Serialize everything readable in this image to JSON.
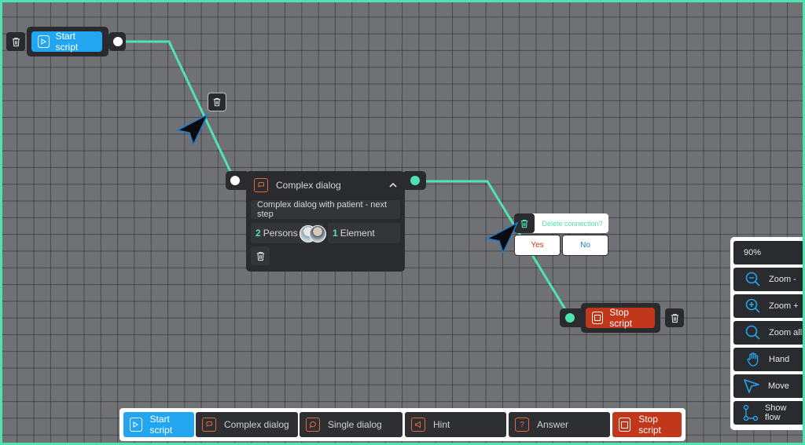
{
  "canvas": {
    "start_node": {
      "label": "Start script"
    },
    "complex_node": {
      "title": "Complex dialog",
      "description": "Complex dialog with  patient - next step",
      "persons_count": "2",
      "persons_label": "Persons",
      "elements_count": "1",
      "elements_label": "Element"
    },
    "stop_node": {
      "label": "Stop script"
    },
    "delete_popup": {
      "question": "Delete connection?",
      "yes": "Yes",
      "no": "No"
    }
  },
  "right_panel": {
    "zoom_level": "90%",
    "items": [
      {
        "label": "Zoom -",
        "icon": "zoom-out-icon"
      },
      {
        "label": "Zoom +",
        "icon": "zoom-in-icon"
      },
      {
        "label": "Zoom all",
        "icon": "zoom-all-icon"
      },
      {
        "label": "Hand",
        "icon": "hand-icon"
      },
      {
        "label": "Move",
        "icon": "cursor-icon"
      },
      {
        "label": "Show flow",
        "icon": "flow-icon"
      }
    ]
  },
  "bottom_toolbar": {
    "items": [
      {
        "label": "Start script",
        "icon": "play-icon"
      },
      {
        "label": "Complex dialog",
        "icon": "complex-dialog-icon"
      },
      {
        "label": "Single dialog",
        "icon": "chat-bubble-icon"
      },
      {
        "label": "Hint",
        "icon": "megaphone-icon"
      },
      {
        "label": "Answer",
        "icon": "question-icon"
      },
      {
        "label": "Stop script",
        "icon": "stop-icon"
      }
    ]
  },
  "colors": {
    "accent_green": "#4fe3b0",
    "start_blue": "#22a6f2",
    "stop_red": "#c2361b",
    "node_dark": "#2a2b2e"
  }
}
